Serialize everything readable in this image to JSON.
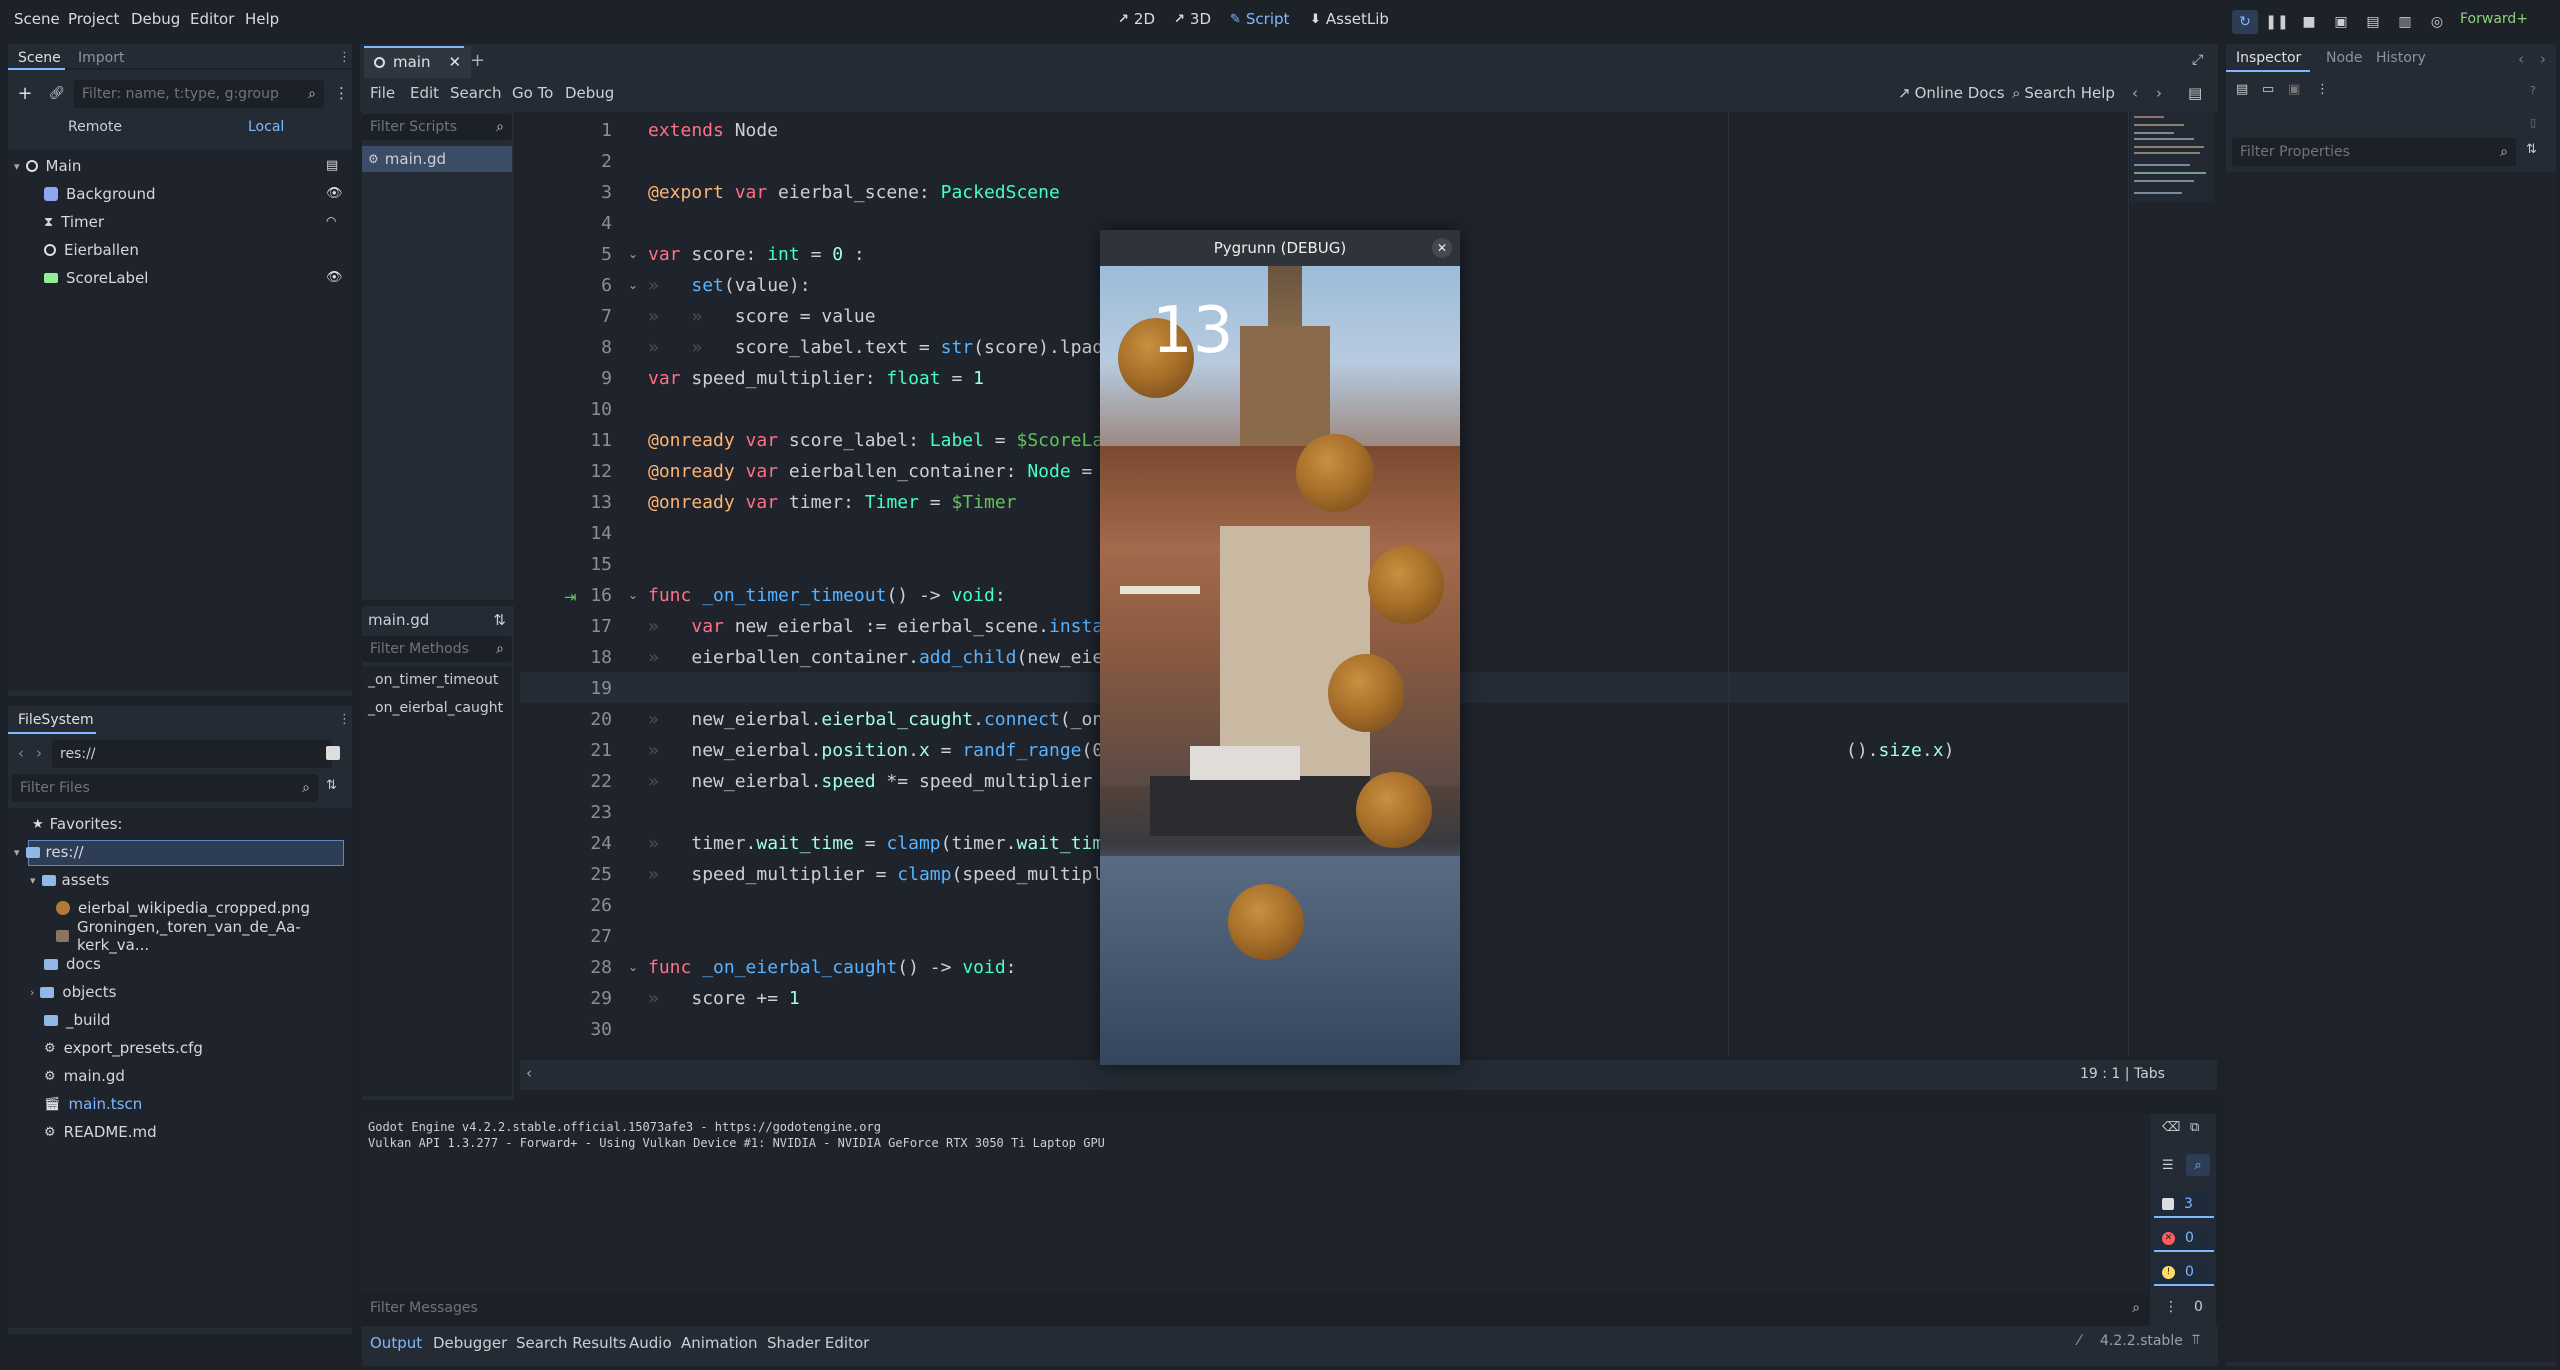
{
  "menu": {
    "scene": "Scene",
    "project": "Project",
    "debug": "Debug",
    "editor": "Editor",
    "help": "Help"
  },
  "workspaces": {
    "w2d": "2D",
    "w3d": "3D",
    "script": "Script",
    "assetlib": "AssetLib"
  },
  "renderer": "Forward+",
  "scene_dock": {
    "tab_scene": "Scene",
    "tab_import": "Import",
    "filter_placeholder": "Filter: name, t:type, g:group",
    "remote": "Remote",
    "local": "Local",
    "nodes": [
      "Main",
      "Background",
      "Timer",
      "Eierballen",
      "ScoreLabel"
    ]
  },
  "filesystem": {
    "title": "FileSystem",
    "path": "res://",
    "filter_placeholder": "Filter Files",
    "favorites": "Favorites:",
    "root": "res://",
    "items": [
      "assets",
      "eierbal_wikipedia_cropped.png",
      "Groningen,_toren_van_de_Aa-kerk_va...",
      "docs",
      "objects",
      "_build",
      "export_presets.cfg",
      "main.gd",
      "main.tscn",
      "README.md"
    ]
  },
  "script_editor": {
    "tab": "main",
    "menu": {
      "file": "File",
      "edit": "Edit",
      "search": "Search",
      "goto": "Go To",
      "debug": "Debug"
    },
    "online_docs": "Online Docs",
    "search_help": "Search Help",
    "filter_scripts": "Filter Scripts",
    "script_item": "main.gd",
    "current_script": "main.gd",
    "filter_methods": "Filter Methods",
    "methods": [
      "_on_timer_timeout",
      "_on_eierbal_caught"
    ],
    "status": "19 :    1  |  Tabs"
  },
  "code_lines": [
    "1",
    "2",
    "3",
    "4",
    "5",
    "6",
    "7",
    "8",
    "9",
    "10",
    "11",
    "12",
    "13",
    "14",
    "15",
    "16",
    "17",
    "18",
    "19",
    "20",
    "21",
    "22",
    "23",
    "24",
    "25",
    "26",
    "27",
    "28",
    "29",
    "30"
  ],
  "code": {
    "l1": [
      "extends",
      " Node"
    ],
    "l3": [
      "@export",
      " var",
      " eierbal_scene: ",
      "PackedScene"
    ],
    "l5": [
      "var",
      " score: ",
      "int",
      " = ",
      "0",
      " :"
    ],
    "l6": [
      "set",
      "(value):"
    ],
    "l7": "score = value",
    "l8": [
      "score_label.text = ",
      "str",
      "(score).lpad"
    ],
    "l9": [
      "var",
      " speed_multiplier: ",
      "float",
      " = ",
      "1"
    ],
    "l11": [
      "@onready",
      " var",
      " score_label: ",
      "Label",
      " = ",
      "$ScoreLa"
    ],
    "l12": [
      "@onready",
      " var",
      " eierballen_container: ",
      "Node",
      " ="
    ],
    "l13": [
      "@onready",
      " var",
      " timer: ",
      "Timer",
      " = ",
      "$Timer"
    ],
    "l16": [
      "func",
      " ",
      "_on_timer_timeout",
      "() -> ",
      "void",
      ":"
    ],
    "l17": [
      "var",
      " new_eierbal := eierbal_scene.",
      "insta"
    ],
    "l18": [
      "eierballen_container.",
      "add_child",
      "(new_eie"
    ],
    "l20": [
      "new_eierbal.",
      "eierbal_caught",
      ".",
      "connect",
      "(_on"
    ],
    "l21": [
      "new_eierbal.",
      "position",
      ".",
      "x",
      " = ",
      "randf_range",
      "(0",
      "().",
      "size",
      ".",
      "x",
      ")"
    ],
    "l22": [
      "new_eierbal.",
      "speed",
      " *= speed_multiplier"
    ],
    "l24": [
      "timer.",
      "wait_time",
      " = ",
      "clamp",
      "(timer.",
      "wait_tim"
    ],
    "l25": [
      "speed_multiplier = ",
      "clamp",
      "(speed_multipl"
    ],
    "l28": [
      "func",
      " ",
      "_on_eierbal_caught",
      "() -> ",
      "void",
      ":"
    ],
    "l29": [
      "score += ",
      "1"
    ]
  },
  "game_window": {
    "title": "Pygrunn (DEBUG)",
    "score": "13"
  },
  "output": {
    "line1": "Godot Engine v4.2.2.stable.official.15073afe3 - https://godotengine.org",
    "line2": "Vulkan API 1.3.277 - Forward+ - Using Vulkan Device #1: NVIDIA - NVIDIA GeForce RTX 3050 Ti Laptop GPU",
    "filter_placeholder": "Filter Messages",
    "count_all": "3",
    "count_errors": "0",
    "count_warnings": "0",
    "count_other": "0"
  },
  "bottom_tabs": [
    "Output",
    "Debugger",
    "Search Results",
    "Audio",
    "Animation",
    "Shader Editor"
  ],
  "version": "4.2.2.stable",
  "inspector": {
    "tab_inspector": "Inspector",
    "tab_node": "Node",
    "tab_history": "History",
    "filter_placeholder": "Filter Properties"
  }
}
